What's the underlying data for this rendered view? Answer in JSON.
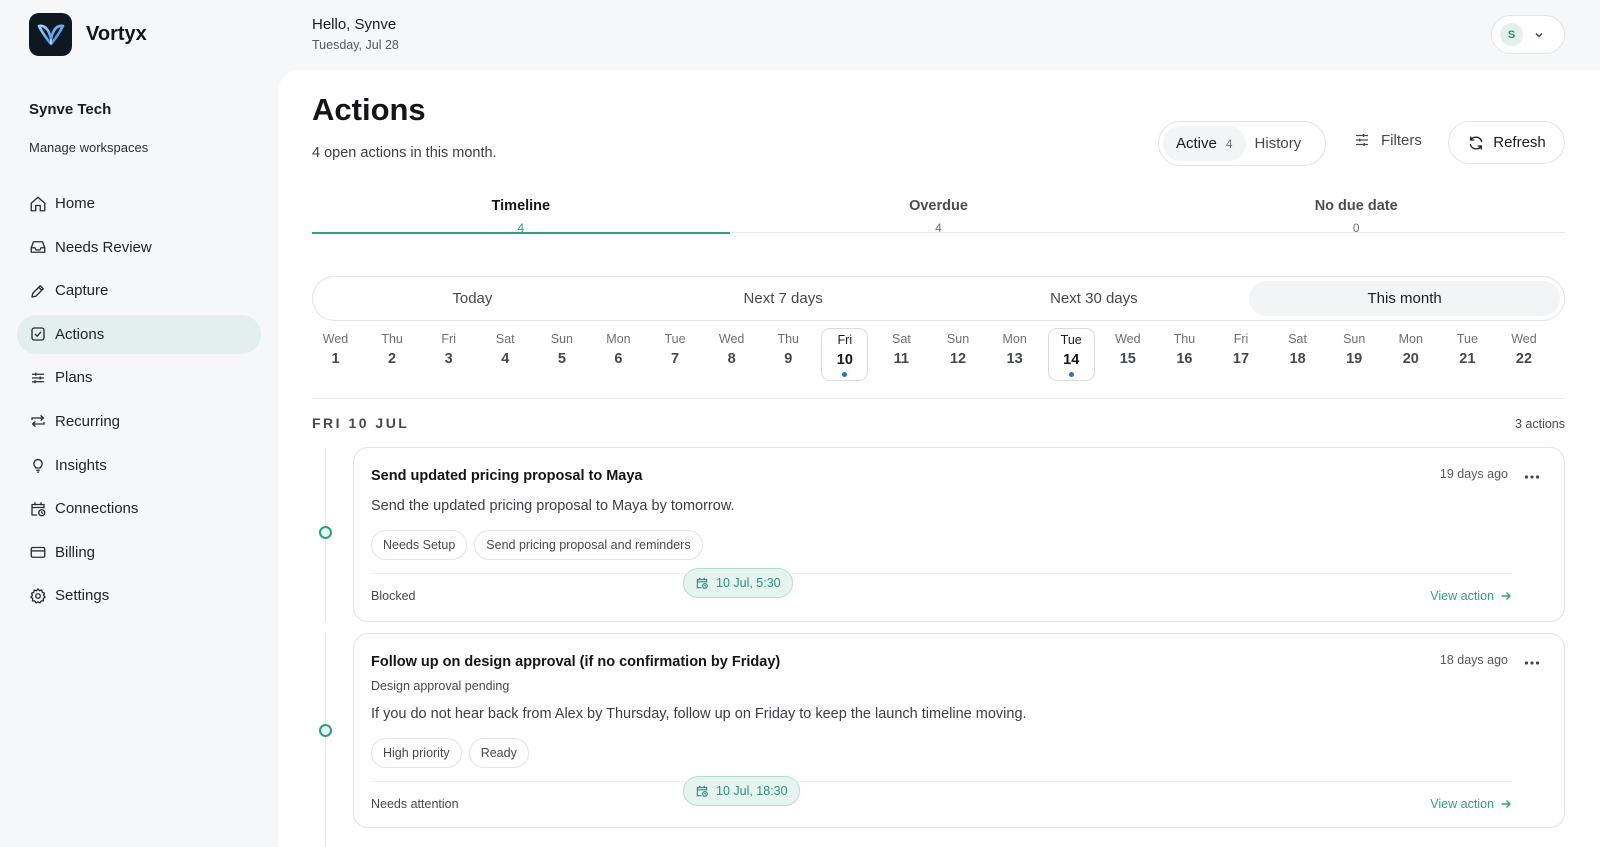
{
  "brand": {
    "name": "Vortyx"
  },
  "workspace": {
    "name": "Synve Tech",
    "manage_label": "Manage workspaces"
  },
  "nav": [
    {
      "label": "Home",
      "icon": "home-icon",
      "active": false
    },
    {
      "label": "Needs Review",
      "icon": "inbox-icon",
      "active": false
    },
    {
      "label": "Capture",
      "icon": "pen-icon",
      "active": false
    },
    {
      "label": "Actions",
      "icon": "checkbox-icon",
      "active": true
    },
    {
      "label": "Plans",
      "icon": "sliders-icon",
      "active": false
    },
    {
      "label": "Recurring",
      "icon": "repeat-icon",
      "active": false
    },
    {
      "label": "Insights",
      "icon": "lightbulb-icon",
      "active": false
    },
    {
      "label": "Connections",
      "icon": "calendar-clock-icon",
      "active": false
    },
    {
      "label": "Billing",
      "icon": "credit-card-icon",
      "active": false
    },
    {
      "label": "Settings",
      "icon": "gear-icon",
      "active": false
    }
  ],
  "header": {
    "greeting": "Hello, Synve",
    "date": "Tuesday, Jul 28",
    "avatar_initial": "S"
  },
  "page": {
    "title": "Actions",
    "subtitle": "4 open actions in this month."
  },
  "toolbar": {
    "active_label": "Active",
    "active_count": "4",
    "history_label": "History",
    "filters_label": "Filters",
    "refresh_label": "Refresh"
  },
  "tabs": [
    {
      "label": "Timeline",
      "count": "4",
      "active": true
    },
    {
      "label": "Overdue",
      "count": "4",
      "active": false
    },
    {
      "label": "No due date",
      "count": "0",
      "active": false
    }
  ],
  "ranges": [
    {
      "label": "Today",
      "selected": false
    },
    {
      "label": "Next 7 days",
      "selected": false
    },
    {
      "label": "Next 30 days",
      "selected": false
    },
    {
      "label": "This month",
      "selected": true
    }
  ],
  "days": [
    {
      "w": "Wed",
      "n": "1",
      "marked": false
    },
    {
      "w": "Thu",
      "n": "2",
      "marked": false
    },
    {
      "w": "Fri",
      "n": "3",
      "marked": false
    },
    {
      "w": "Sat",
      "n": "4",
      "marked": false
    },
    {
      "w": "Sun",
      "n": "5",
      "marked": false
    },
    {
      "w": "Mon",
      "n": "6",
      "marked": false
    },
    {
      "w": "Tue",
      "n": "7",
      "marked": false
    },
    {
      "w": "Wed",
      "n": "8",
      "marked": false
    },
    {
      "w": "Thu",
      "n": "9",
      "marked": false
    },
    {
      "w": "Fri",
      "n": "10",
      "marked": true
    },
    {
      "w": "Sat",
      "n": "11",
      "marked": false
    },
    {
      "w": "Sun",
      "n": "12",
      "marked": false
    },
    {
      "w": "Mon",
      "n": "13",
      "marked": false
    },
    {
      "w": "Tue",
      "n": "14",
      "marked": true
    },
    {
      "w": "Wed",
      "n": "15",
      "marked": false
    },
    {
      "w": "Thu",
      "n": "16",
      "marked": false
    },
    {
      "w": "Fri",
      "n": "17",
      "marked": false
    },
    {
      "w": "Sat",
      "n": "18",
      "marked": false
    },
    {
      "w": "Sun",
      "n": "19",
      "marked": false
    },
    {
      "w": "Mon",
      "n": "20",
      "marked": false
    },
    {
      "w": "Tue",
      "n": "21",
      "marked": false
    },
    {
      "w": "Wed",
      "n": "22",
      "marked": false
    }
  ],
  "group": {
    "date_label": "FRI 10 JUL",
    "count_label": "3 actions"
  },
  "cards": [
    {
      "title": "Send updated pricing proposal to Maya",
      "description": "Send the updated pricing proposal to Maya by tomorrow.",
      "age": "19 days ago",
      "date_chip": "10 Jul, 5:30",
      "chips": [
        "Needs Setup",
        "Send pricing proposal and reminders"
      ],
      "status": "Blocked",
      "link": "View action"
    },
    {
      "title": "Follow up on design approval (if no confirmation by Friday)",
      "subtitle": "Design approval pending",
      "description": "If you do not hear back from Alex by Thursday, follow up on Friday to keep the launch timeline moving.",
      "age": "18 days ago",
      "date_chip": "10 Jul, 18:30",
      "chips": [
        "High priority",
        "Ready"
      ],
      "status": "Needs attention",
      "link": "View action"
    }
  ],
  "colors": {
    "accent": "#2f9e86",
    "active_nav_bg": "#e3efec",
    "dot_marker": "#2b6fd6"
  }
}
